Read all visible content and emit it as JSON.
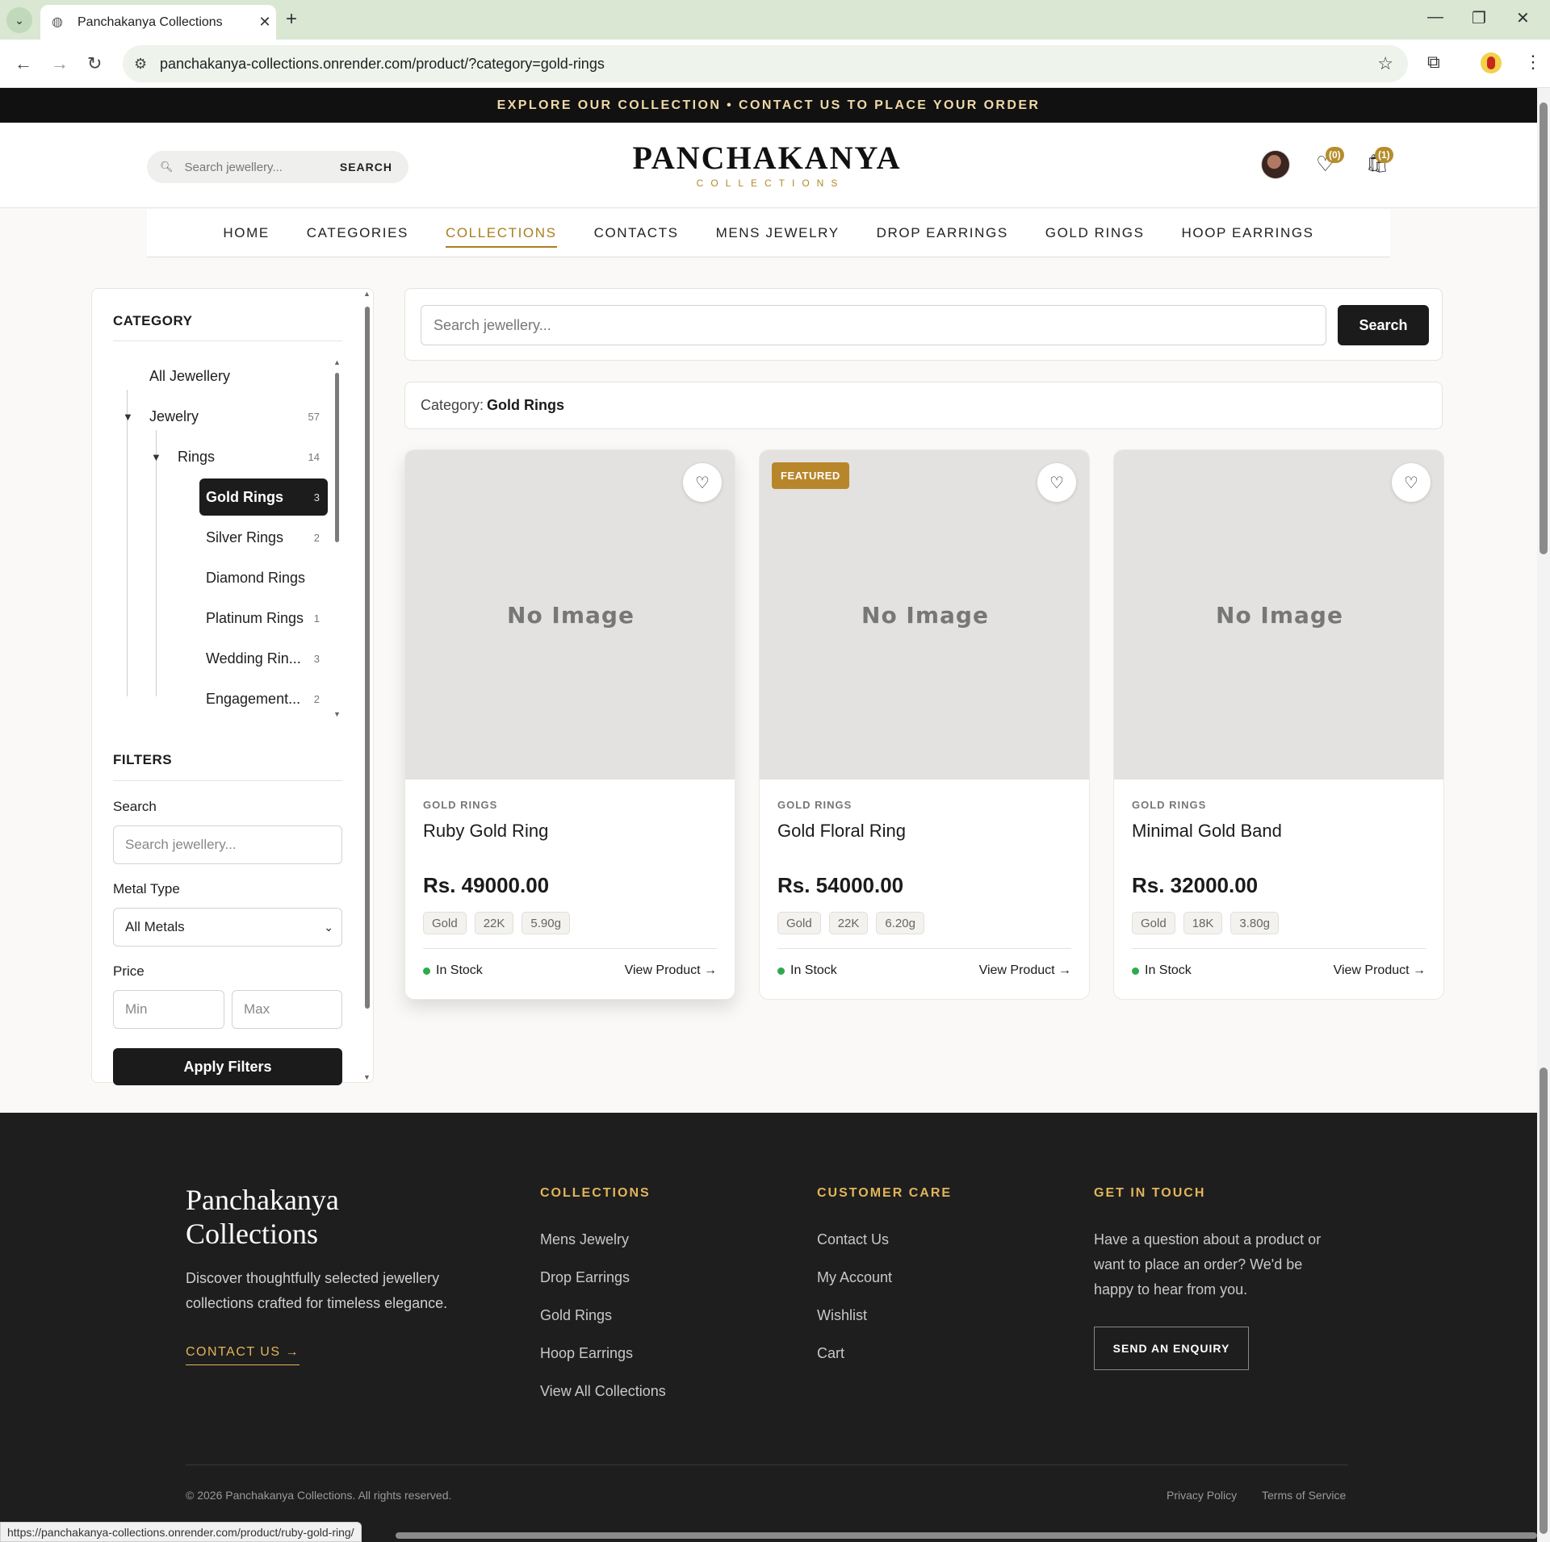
{
  "browser": {
    "tab_title": "Panchakanya Collections",
    "url": "panchakanya-collections.onrender.com/product/?category=gold-rings",
    "status_url": "https://panchakanya-collections.onrender.com/product/ruby-gold-ring/"
  },
  "announcement": "EXPLORE OUR COLLECTION • CONTACT US TO PLACE YOUR ORDER",
  "header": {
    "search_placeholder": "Search jewellery...",
    "search_button": "SEARCH",
    "logo_main": "PANCHAKANYA",
    "logo_sub": "COLLECTIONS",
    "wishlist_count": "(0)",
    "cart_count": "(1)"
  },
  "nav": [
    "HOME",
    "CATEGORIES",
    "COLLECTIONS",
    "CONTACTS",
    "MENS JEWELRY",
    "DROP EARRINGS",
    "GOLD RINGS",
    "HOOP EARRINGS"
  ],
  "nav_active": "COLLECTIONS",
  "sidebar": {
    "category_title": "CATEGORY",
    "categories": [
      {
        "label": "All Jewellery",
        "count": ""
      },
      {
        "label": "Jewelry",
        "count": "57"
      },
      {
        "label": "Rings",
        "count": "14"
      },
      {
        "label": "Gold Rings",
        "count": "3"
      },
      {
        "label": "Silver Rings",
        "count": "2"
      },
      {
        "label": "Diamond Rings",
        "count": ""
      },
      {
        "label": "Platinum Rings",
        "count": "1"
      },
      {
        "label": "Wedding Rin...",
        "count": "3"
      },
      {
        "label": "Engagement...",
        "count": "2"
      }
    ],
    "filters_title": "FILTERS",
    "search_label": "Search",
    "search_placeholder": "Search jewellery...",
    "metal_label": "Metal Type",
    "metal_value": "All Metals",
    "price_label": "Price",
    "min_placeholder": "Min",
    "max_placeholder": "Max",
    "apply_button": "Apply Filters"
  },
  "main": {
    "search_placeholder": "Search jewellery...",
    "search_button": "Search",
    "category_prefix": "Category:",
    "category_value": "Gold Rings",
    "products": [
      {
        "image_text": "No Image",
        "badge": "",
        "category": "GOLD RINGS",
        "name": "Ruby Gold Ring",
        "price": "Rs. 49000.00",
        "tags": [
          "Gold",
          "22K",
          "5.90g"
        ],
        "stock": "In Stock",
        "link": "View Product →"
      },
      {
        "image_text": "No Image",
        "badge": "FEATURED",
        "category": "GOLD RINGS",
        "name": "Gold Floral Ring",
        "price": "Rs. 54000.00",
        "tags": [
          "Gold",
          "22K",
          "6.20g"
        ],
        "stock": "In Stock",
        "link": "View Product →"
      },
      {
        "image_text": "No Image",
        "badge": "",
        "category": "GOLD RINGS",
        "name": "Minimal Gold Band",
        "price": "Rs. 32000.00",
        "tags": [
          "Gold",
          "18K",
          "3.80g"
        ],
        "stock": "In Stock",
        "link": "View Product →"
      }
    ]
  },
  "footer": {
    "brand": "Panchakanya Collections",
    "description": "Discover thoughtfully selected jewellery collections crafted for timeless elegance.",
    "contact_link": "CONTACT US →",
    "collections_title": "COLLECTIONS",
    "collections": [
      "Mens Jewelry",
      "Drop Earrings",
      "Gold Rings",
      "Hoop Earrings",
      "View All Collections"
    ],
    "care_title": "CUSTOMER CARE",
    "care": [
      "Contact Us",
      "My Account",
      "Wishlist",
      "Cart"
    ],
    "touch_title": "GET IN TOUCH",
    "touch_text": "Have a question about a product or want to place an order? We'd be happy to hear from you.",
    "enquiry_button": "SEND AN ENQUIRY",
    "copyright": "© 2026 Panchakanya Collections. All rights reserved.",
    "privacy": "Privacy Policy",
    "terms": "Terms of Service"
  },
  "colors": {
    "accent_gold": "#b58d2b",
    "dark": "#1b1b1b",
    "footer_bg": "#1e1e1e"
  }
}
